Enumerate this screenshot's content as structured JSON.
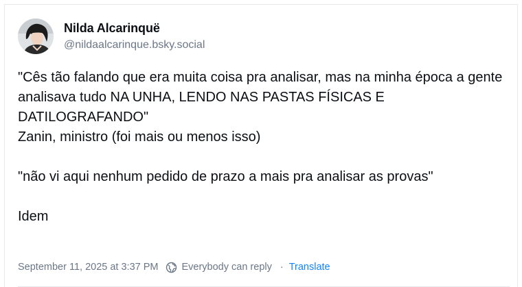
{
  "post": {
    "author": {
      "display_name": "Nilda Alcarinquë",
      "handle": "@nildaalcarinque.bsky.social",
      "avatar_icon": "user-avatar-photo"
    },
    "text": "\"Cês tão falando que era muita coisa pra analisar, mas na minha época a gente analisava tudo NA UNHA, LENDO NAS PASTAS FÍSICAS E DATILOGRAFANDO\"\nZanin, ministro (foi mais ou menos isso)\n\n\"não vi aqui nenhum pedido de prazo a mais pra analisar as provas\"\n\nIdem",
    "meta": {
      "timestamp": "September 11, 2025 at 3:37 PM",
      "reply_setting": "Everybody can reply",
      "reply_icon": "globe-icon",
      "separator": "·",
      "translate_label": "Translate"
    }
  },
  "colors": {
    "text": "#0b0f14",
    "muted": "#6b7787",
    "link": "#1083fe",
    "border": "#e6e8ec"
  }
}
